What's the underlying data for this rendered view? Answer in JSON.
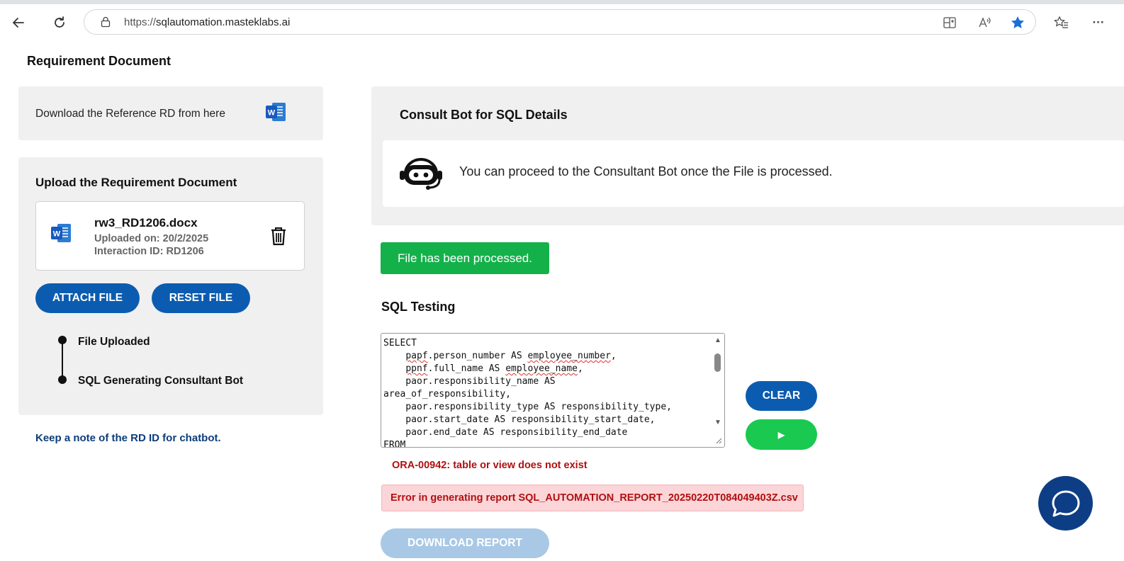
{
  "browser": {
    "url_proto": "https://",
    "url_host": "sqlautomation.masteklabs.ai",
    "more_label": "···"
  },
  "page": {
    "title": "Requirement Document"
  },
  "download_panel": {
    "text": "Download the Reference RD from here"
  },
  "upload_panel": {
    "title": "Upload the Requirement Document",
    "file": {
      "name": "rw3_RD1206.docx",
      "uploaded_on": "Uploaded on: 20/2/2025",
      "interaction_id": "Interaction ID: RD1206"
    },
    "attach_label": "ATTACH FILE",
    "reset_label": "RESET FILE",
    "timeline": [
      "File Uploaded",
      "SQL Generating Consultant Bot"
    ]
  },
  "note": "Keep a note of the RD ID for chatbot.",
  "consult": {
    "title": "Consult Bot for SQL Details",
    "message": "You can proceed to the Consultant Bot once the File is processed."
  },
  "status": {
    "processed": "File has been processed."
  },
  "sql_testing": {
    "heading": "SQL Testing",
    "query_lines": [
      "SELECT",
      "    papf.person_number AS employee_number,",
      "    ppnf.full_name AS employee_name,",
      "    paor.responsibility_name AS",
      "area_of_responsibility,",
      "    paor.responsibility_type AS responsibility_type,",
      "    paor.start_date AS responsibility_start_date,",
      "    paor.end_date AS responsibility_end_date",
      "FROM"
    ],
    "clear_label": "CLEAR",
    "run_label": "▶",
    "ora_error": "ORA-00942: table or view does not exist",
    "report_error": "Error in generating report SQL_AUTOMATION_REPORT_20250220T084049403Z.csv",
    "download_label": "DOWNLOAD REPORT"
  },
  "colors": {
    "primary_blue": "#0b5cb0",
    "success_green": "#14b14b",
    "run_green": "#19c950",
    "error_red": "#b01010",
    "error_bg": "#fbd5d8",
    "disabled_blue": "#a9c8e6",
    "panel_gray": "#f0f0f0",
    "chat_navy": "#0d3e85"
  },
  "icons": [
    "back-icon",
    "refresh-icon",
    "lock-icon",
    "split-screen-icon",
    "read-aloud-icon",
    "favorite-star-icon",
    "favorites-list-icon",
    "more-icon",
    "word-doc-icon",
    "trash-icon",
    "bot-headset-icon",
    "play-icon",
    "chat-icon"
  ]
}
